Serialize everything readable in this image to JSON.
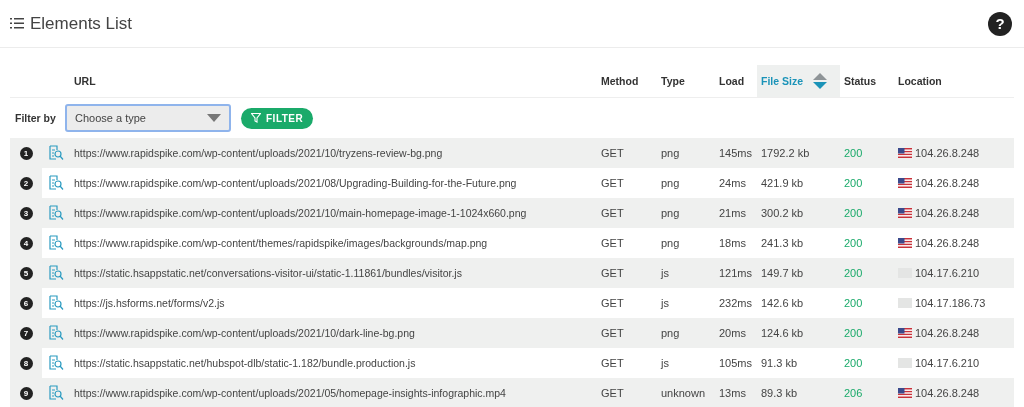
{
  "header": {
    "title": "Elements List",
    "help": "?"
  },
  "table": {
    "columns": [
      {
        "label": "URL",
        "sorted": false
      },
      {
        "label": "Method",
        "sorted": false
      },
      {
        "label": "Type",
        "sorted": false
      },
      {
        "label": "Load",
        "sorted": false
      },
      {
        "label": "File Size",
        "sorted": true
      },
      {
        "label": "Status",
        "sorted": false
      },
      {
        "label": "Location",
        "sorted": false
      }
    ],
    "filter": {
      "label": "Filter by",
      "placeholder": "Choose a type",
      "button": "FILTER"
    },
    "rows": [
      {
        "index": "1",
        "url": "https://www.rapidspike.com/wp-content/uploads/2021/10/tryzens-review-bg.png",
        "method": "GET",
        "type": "png",
        "load": "145ms",
        "size": "1792.2 kb",
        "status": "200",
        "flag": true,
        "location": "104.26.8.248"
      },
      {
        "index": "2",
        "url": "https://www.rapidspike.com/wp-content/uploads/2021/08/Upgrading-Building-for-the-Future.png",
        "method": "GET",
        "type": "png",
        "load": "24ms",
        "size": "421.9 kb",
        "status": "200",
        "flag": true,
        "location": "104.26.8.248"
      },
      {
        "index": "3",
        "url": "https://www.rapidspike.com/wp-content/uploads/2021/10/main-homepage-image-1-1024x660.png",
        "method": "GET",
        "type": "png",
        "load": "21ms",
        "size": "300.2 kb",
        "status": "200",
        "flag": true,
        "location": "104.26.8.248"
      },
      {
        "index": "4",
        "url": "https://www.rapidspike.com/wp-content/themes/rapidspike/images/backgrounds/map.png",
        "method": "GET",
        "type": "png",
        "load": "18ms",
        "size": "241.3 kb",
        "status": "200",
        "flag": true,
        "location": "104.26.8.248"
      },
      {
        "index": "5",
        "url": "https://static.hsappstatic.net/conversations-visitor-ui/static-1.11861/bundles/visitor.js",
        "method": "GET",
        "type": "js",
        "load": "121ms",
        "size": "149.7 kb",
        "status": "200",
        "flag": false,
        "location": "104.17.6.210"
      },
      {
        "index": "6",
        "url": "https://js.hsforms.net/forms/v2.js",
        "method": "GET",
        "type": "js",
        "load": "232ms",
        "size": "142.6 kb",
        "status": "200",
        "flag": false,
        "location": "104.17.186.73"
      },
      {
        "index": "7",
        "url": "https://www.rapidspike.com/wp-content/uploads/2021/10/dark-line-bg.png",
        "method": "GET",
        "type": "png",
        "load": "20ms",
        "size": "124.6 kb",
        "status": "200",
        "flag": true,
        "location": "104.26.8.248"
      },
      {
        "index": "8",
        "url": "https://static.hsappstatic.net/hubspot-dlb/static-1.182/bundle.production.js",
        "method": "GET",
        "type": "js",
        "load": "105ms",
        "size": "91.3 kb",
        "status": "200",
        "flag": false,
        "location": "104.17.6.210"
      },
      {
        "index": "9",
        "url": "https://www.rapidspike.com/wp-content/uploads/2021/05/homepage-insights-infographic.mp4",
        "method": "GET",
        "type": "unknown",
        "load": "13ms",
        "size": "89.3 kb",
        "status": "206",
        "flag": true,
        "location": "104.26.8.248"
      }
    ]
  }
}
